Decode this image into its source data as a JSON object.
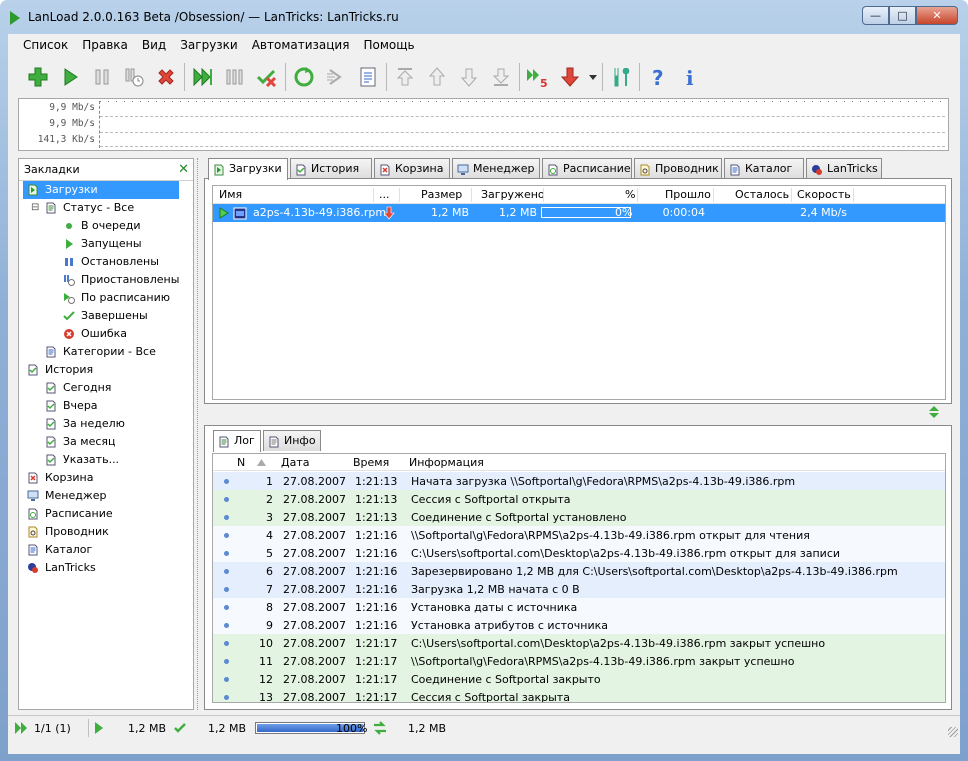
{
  "window": {
    "title": "LanLoad 2.0.0.163 Beta /Obsession/ — LanTricks: LanTricks.ru",
    "minimize": "—",
    "maximize": "□",
    "close": "✕"
  },
  "menu": [
    "Список",
    "Правка",
    "Вид",
    "Загрузки",
    "Автоматизация",
    "Помощь"
  ],
  "toolbar_icons": [
    "add-icon",
    "start-icon",
    "pause-icon",
    "schedule-pause-icon",
    "delete-icon",
    "start-all-icon",
    "pause-all-icon",
    "remove-completed-icon",
    "refresh-icon",
    "next-icon",
    "properties-icon",
    "move-top-icon",
    "move-up-icon",
    "move-down-icon",
    "move-bottom-icon",
    "threads-icon",
    "speed-limit-icon",
    "dropdown-icon",
    "settings-icon",
    "help-icon",
    "info-icon"
  ],
  "graph": {
    "labels": [
      "9,9 Mb/s",
      "9,9 Mb/s",
      "141,3 Kb/s"
    ]
  },
  "sidebar": {
    "header": "Закладки",
    "close_label": "✕",
    "items": [
      {
        "label": "Загрузки",
        "icon": "downloads-icon",
        "level": 0,
        "selected": true
      },
      {
        "label": "Статус - Все",
        "icon": "status-icon",
        "level": 1
      },
      {
        "label": "В очереди",
        "icon": "queued-icon",
        "level": 2
      },
      {
        "label": "Запущены",
        "icon": "running-icon",
        "level": 2
      },
      {
        "label": "Остановлены",
        "icon": "stopped-icon",
        "level": 2
      },
      {
        "label": "Приостановлены",
        "icon": "paused-icon",
        "level": 2
      },
      {
        "label": "По расписанию",
        "icon": "scheduled-icon",
        "level": 2
      },
      {
        "label": "Завершены",
        "icon": "completed-icon",
        "level": 2
      },
      {
        "label": "Ошибка",
        "icon": "error-icon",
        "level": 2
      },
      {
        "label": "Категории - Все",
        "icon": "categories-icon",
        "level": 1
      },
      {
        "label": "История",
        "icon": "history-icon",
        "level": 0
      },
      {
        "label": "Сегодня",
        "icon": "history-today-icon",
        "level": 1
      },
      {
        "label": "Вчера",
        "icon": "history-yesterday-icon",
        "level": 1
      },
      {
        "label": "За неделю",
        "icon": "history-week-icon",
        "level": 1
      },
      {
        "label": "За месяц",
        "icon": "history-month-icon",
        "level": 1
      },
      {
        "label": "Указать...",
        "icon": "history-custom-icon",
        "level": 1
      },
      {
        "label": "Корзина",
        "icon": "trash-icon",
        "level": 0
      },
      {
        "label": "Менеджер",
        "icon": "manager-icon",
        "level": 0
      },
      {
        "label": "Расписание",
        "icon": "schedule-icon",
        "level": 0
      },
      {
        "label": "Проводник",
        "icon": "explorer-icon",
        "level": 0
      },
      {
        "label": "Каталог",
        "icon": "catalog-icon",
        "level": 0
      },
      {
        "label": "LanTricks",
        "icon": "lantricks-icon",
        "level": 0
      }
    ]
  },
  "tabs": [
    {
      "label": "Загрузки",
      "active": true
    },
    {
      "label": "История"
    },
    {
      "label": "Корзина"
    },
    {
      "label": "Менеджер"
    },
    {
      "label": "Расписание"
    },
    {
      "label": "Проводник"
    },
    {
      "label": "Каталог"
    },
    {
      "label": "LanTricks"
    }
  ],
  "downloads": {
    "columns": [
      "Имя",
      "...",
      "Размер",
      "Загружено",
      "%",
      "Прошло",
      "Осталось",
      "Скорость"
    ],
    "rows": [
      {
        "name": "a2ps-4.13b-49.i386.rpm",
        "size": "1,2 MB",
        "downloaded": "1,2 MB",
        "percent": "0%",
        "progress_fraction": 0.0,
        "elapsed": "0:00:04",
        "remaining": "",
        "speed": "2,4 Mb/s"
      }
    ]
  },
  "log_tabs": [
    {
      "label": "Лог",
      "active": true
    },
    {
      "label": "Инфо"
    }
  ],
  "log": {
    "columns": [
      "N",
      "Дата",
      "Время",
      "Информация"
    ],
    "rows": [
      {
        "n": "1",
        "date": "27.08.2007",
        "time": "1:21:13",
        "info": "Начата загрузка \\\\Softportal\\g\\Fedora\\RPMS\\a2ps-4.13b-49.i386.rpm",
        "tone": "blue"
      },
      {
        "n": "2",
        "date": "27.08.2007",
        "time": "1:21:13",
        "info": "Сессия с Softportal открыта",
        "tone": "green"
      },
      {
        "n": "3",
        "date": "27.08.2007",
        "time": "1:21:13",
        "info": "Соединение с Softportal установлено",
        "tone": "green"
      },
      {
        "n": "4",
        "date": "27.08.2007",
        "time": "1:21:16",
        "info": "\\\\Softportal\\g\\Fedora\\RPMS\\a2ps-4.13b-49.i386.rpm открыт для чтения",
        "tone": "white"
      },
      {
        "n": "5",
        "date": "27.08.2007",
        "time": "1:21:16",
        "info": "C:\\Users\\softportal.com\\Desktop\\a2ps-4.13b-49.i386.rpm открыт для записи",
        "tone": "white"
      },
      {
        "n": "6",
        "date": "27.08.2007",
        "time": "1:21:16",
        "info": "Зарезервировано 1,2 MB для C:\\Users\\softportal.com\\Desktop\\a2ps-4.13b-49.i386.rpm",
        "tone": "blue"
      },
      {
        "n": "7",
        "date": "27.08.2007",
        "time": "1:21:16",
        "info": "Загрузка 1,2 MB начата с 0 B",
        "tone": "blue"
      },
      {
        "n": "8",
        "date": "27.08.2007",
        "time": "1:21:16",
        "info": "Установка даты с источника",
        "tone": "white"
      },
      {
        "n": "9",
        "date": "27.08.2007",
        "time": "1:21:16",
        "info": "Установка атрибутов с источника",
        "tone": "white"
      },
      {
        "n": "10",
        "date": "27.08.2007",
        "time": "1:21:17",
        "info": "C:\\Users\\softportal.com\\Desktop\\a2ps-4.13b-49.i386.rpm закрыт успешно",
        "tone": "green"
      },
      {
        "n": "11",
        "date": "27.08.2007",
        "time": "1:21:17",
        "info": "\\\\Softportal\\g\\Fedora\\RPMS\\a2ps-4.13b-49.i386.rpm закрыт успешно",
        "tone": "green"
      },
      {
        "n": "12",
        "date": "27.08.2007",
        "time": "1:21:17",
        "info": "Соединение с Softportal закрыто",
        "tone": "green"
      },
      {
        "n": "13",
        "date": "27.08.2007",
        "time": "1:21:17",
        "info": "Сессия с Softportal закрыта",
        "tone": "green"
      }
    ]
  },
  "status": {
    "count": "1/1 (1)",
    "running_size": "1,2 MB",
    "done_size": "1,2 MB",
    "percent": "100%",
    "progress_fraction": 1.0,
    "transfer_size": "1,2 MB"
  },
  "colors": {
    "accent": "#3399ff",
    "green": "#2d9a2d",
    "red": "#d63b2b"
  }
}
